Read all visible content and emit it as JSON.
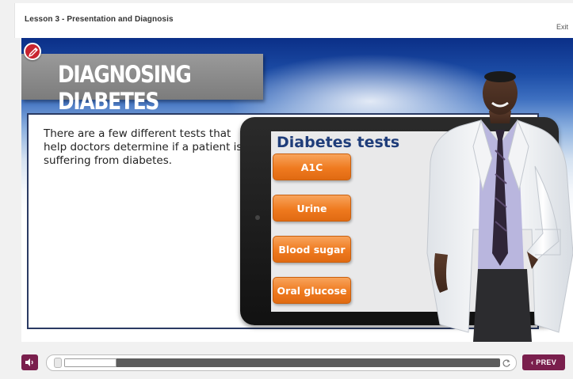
{
  "header": {
    "lesson_title": "Lesson 3 - Presentation and Diagnosis",
    "exit_label": "Exit"
  },
  "slide": {
    "title": "DIAGNOSING DIABETES",
    "body_text": "There are a few different tests that help doctors determine if a patient is suffering from diabetes.",
    "tablet": {
      "heading": "Diabetes tests",
      "tests": [
        "A1C",
        "Urine",
        "Blood sugar",
        "Oral glucose"
      ]
    },
    "icons": {
      "badge": "pencil-icon",
      "presenter": "doctor-illustration"
    }
  },
  "controls": {
    "volume_icon": "speaker-icon",
    "replay_icon": "replay-icon",
    "progress_fraction": 0.12,
    "prev_chevron": "‹",
    "prev_label": "PREV"
  },
  "colors": {
    "accent": "#7a1f4d",
    "button_orange": "#ef7a1f",
    "title_banner": "#8a8a8a",
    "heading_blue": "#1f3d7a",
    "badge_red": "#c8242f"
  }
}
